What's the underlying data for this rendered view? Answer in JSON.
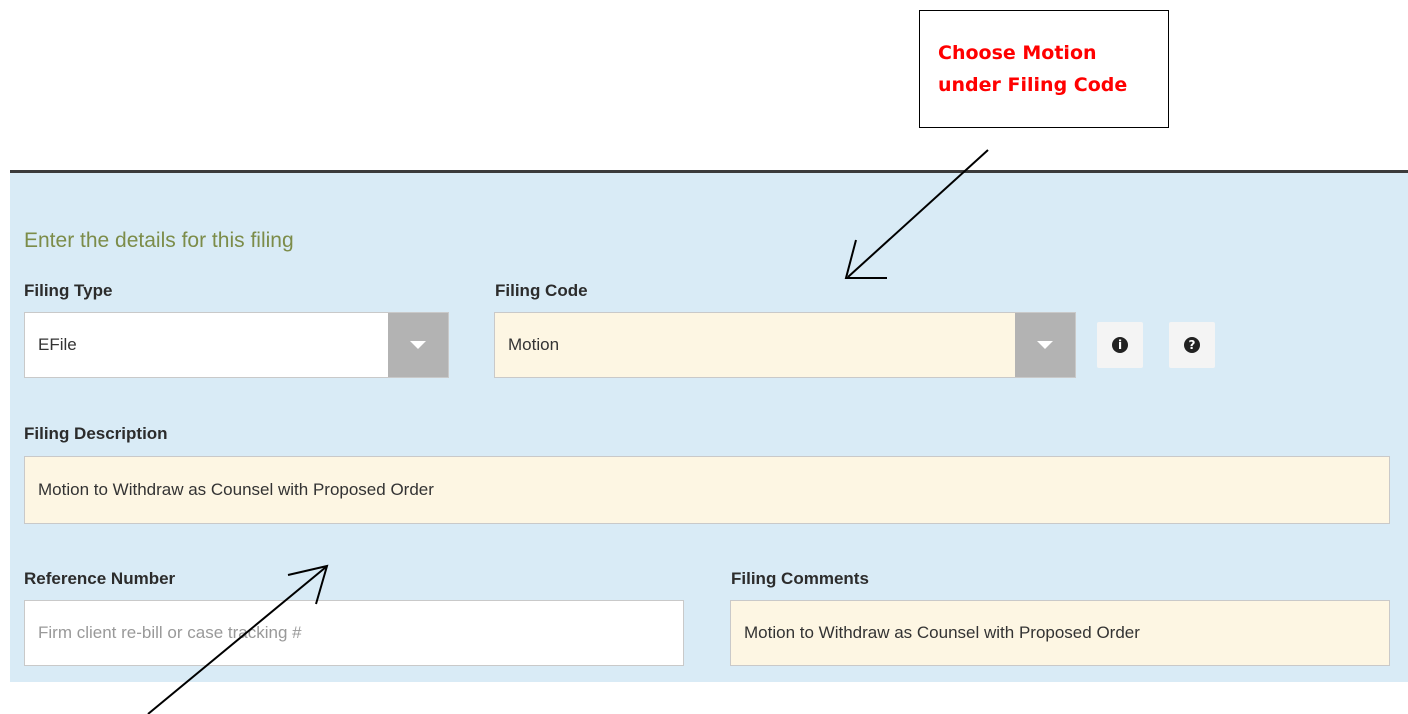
{
  "annotation": {
    "line1": "Choose Motion",
    "line2": "under Filing Code"
  },
  "form": {
    "heading": "Enter the details for this filing",
    "filing_type": {
      "label": "Filing Type",
      "value": "EFile"
    },
    "filing_code": {
      "label": "Filing Code",
      "value": "Motion"
    },
    "filing_description": {
      "label": "Filing Description",
      "value": "Motion to Withdraw as Counsel with Proposed Order"
    },
    "reference_number": {
      "label": "Reference Number",
      "placeholder": "Firm client re-bill or case tracking #"
    },
    "filing_comments": {
      "label": "Filing Comments",
      "value": "Motion to Withdraw as Counsel with Proposed Order"
    },
    "icons": {
      "info": "info-icon",
      "help": "question-icon"
    }
  }
}
